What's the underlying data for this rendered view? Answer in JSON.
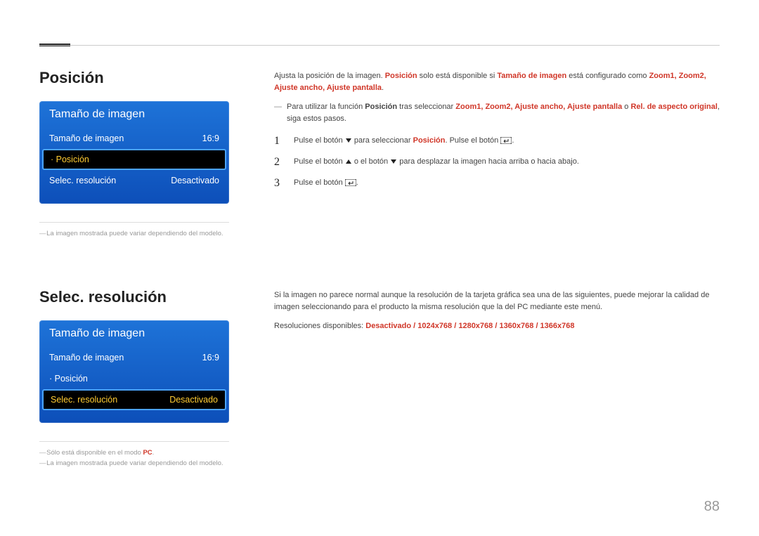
{
  "page_number": "88",
  "section1": {
    "heading": "Posición",
    "osd": {
      "title": "Tamaño de imagen",
      "rows": [
        {
          "label": "Tamaño de imagen",
          "value": "16:9",
          "selected": false,
          "dot": false
        },
        {
          "label": "Posición",
          "value": "",
          "selected": true,
          "dot": true
        },
        {
          "label": "Selec. resolución",
          "value": "Desactivado",
          "selected": false,
          "dot": false
        }
      ]
    },
    "footnote1": "La imagen mostrada puede variar dependiendo del modelo.",
    "intro_pre": "Ajusta la posición de la imagen. ",
    "intro_b1": "Posición",
    "intro_mid": " solo está disponible si ",
    "intro_b2": "Tamaño de imagen",
    "intro_post": " está configurado como ",
    "intro_opts": "Zoom1, Zoom2, Ajuste ancho, Ajuste pantalla",
    "intro_end": ".",
    "note_pre": "Para utilizar la función ",
    "note_b1": "Posición",
    "note_mid": " tras seleccionar ",
    "note_opts": "Zoom1, Zoom2, Ajuste ancho, Ajuste pantalla",
    "note_or": "  o ",
    "note_b2": "Rel. de aspecto original",
    "note_end": ", siga estos pasos.",
    "step1_a": "Pulse el botón ",
    "step1_b": " para seleccionar ",
    "step1_c": "Posición",
    "step1_d": ". Pulse el botón ",
    "step1_e": ".",
    "step2_a": "Pulse el botón ",
    "step2_b": " o el botón ",
    "step2_c": " para desplazar la imagen hacia arriba o hacia abajo.",
    "step3_a": "Pulse el botón ",
    "step3_b": "."
  },
  "section2": {
    "heading": "Selec. resolución",
    "osd": {
      "title": "Tamaño de imagen",
      "rows": [
        {
          "label": "Tamaño de imagen",
          "value": "16:9",
          "selected": false,
          "dot": false
        },
        {
          "label": "Posición",
          "value": "",
          "selected": false,
          "dot": true
        },
        {
          "label": "Selec. resolución",
          "value": "Desactivado",
          "selected": true,
          "dot": false
        }
      ]
    },
    "footnote1_pre": "Sólo está disponible en el modo ",
    "footnote1_b": "PC",
    "footnote1_post": ".",
    "footnote2": "La imagen mostrada puede variar dependiendo del modelo.",
    "body": "Si la imagen no parece normal aunque la resolución de la tarjeta gráfica sea una de las siguientes, puede mejorar la calidad de imagen seleccionando para el producto la misma resolución que la del PC mediante este menú.",
    "res_label": "Resoluciones disponibles: ",
    "res_opts": "Desactivado / 1024x768 / 1280x768 / 1360x768 / 1366x768"
  }
}
